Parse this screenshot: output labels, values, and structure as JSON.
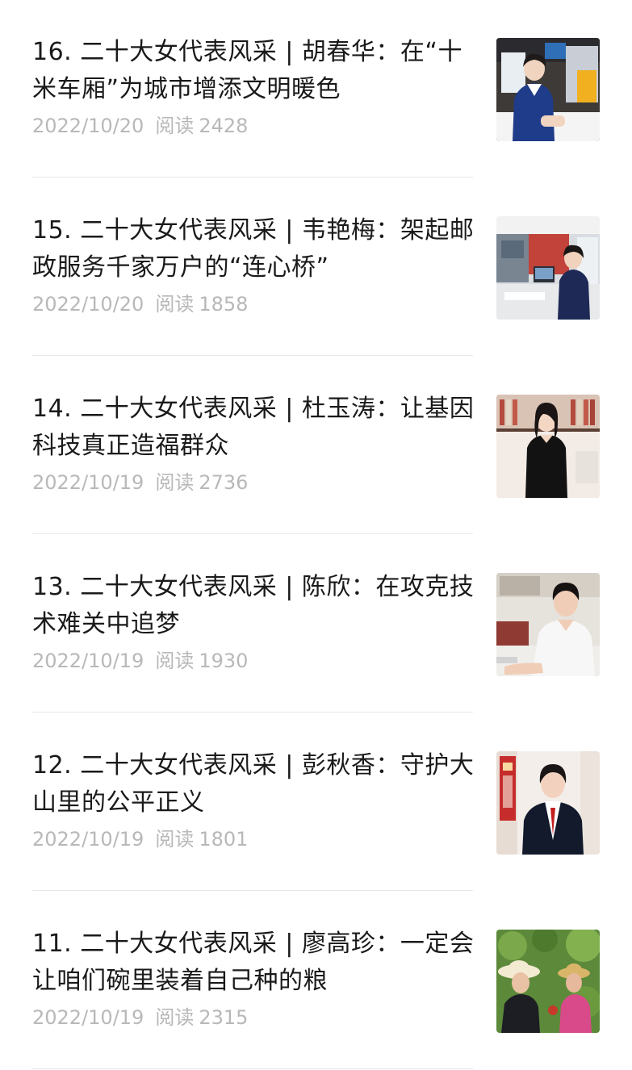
{
  "articles": [
    {
      "title": "16. 二十大女代表风采 | 胡春华：在“十米车厢”为城市增添文明暖色",
      "date": "2022/10/20",
      "read_label": "阅读",
      "read_count": "2428",
      "thumbnail_icon": "bus-attendant-photo"
    },
    {
      "title": "15. 二十大女代表风采 | 韦艳梅：架起邮政服务千家万户的“连心桥”",
      "date": "2022/10/20",
      "read_label": "阅读",
      "read_count": "1858",
      "thumbnail_icon": "postal-office-photo"
    },
    {
      "title": "14. 二十大女代表风采 | 杜玉涛：让基因科技真正造福群众",
      "date": "2022/10/19",
      "read_label": "阅读",
      "read_count": "2736",
      "thumbnail_icon": "scientist-portrait-photo"
    },
    {
      "title": "13. 二十大女代表风采 | 陈欣：在攻克技术难关中追梦",
      "date": "2022/10/19",
      "read_label": "阅读",
      "read_count": "1930",
      "thumbnail_icon": "lab-worker-photo"
    },
    {
      "title": "12. 二十大女代表风采 | 彭秋香：守护大山里的公平正义",
      "date": "2022/10/19",
      "read_label": "阅读",
      "read_count": "1801",
      "thumbnail_icon": "judge-portrait-photo"
    },
    {
      "title": "11. 二十大女代表风采 | 廖高珍：一定会让咱们碗里装着自己种的粮",
      "date": "2022/10/19",
      "read_label": "阅读",
      "read_count": "2315",
      "thumbnail_icon": "farmers-field-photo"
    }
  ]
}
